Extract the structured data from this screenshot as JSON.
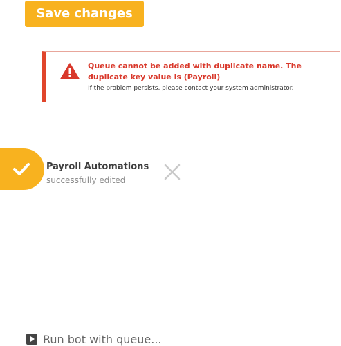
{
  "save_button": {
    "label": "Save changes"
  },
  "error_alert": {
    "icon": "warning-icon",
    "title": "Queue cannot be added with duplicate name. The duplicate key value is (Payroll)",
    "message": "If the problem persists, please contact your system administrator.",
    "accent_color": "#e0452b"
  },
  "toast": {
    "icon": "check-icon",
    "title": "Payroll Automations",
    "message": "successfully edited",
    "accent_color": "#f8b21f"
  },
  "run_bot": {
    "icon": "play-icon",
    "label": "Run bot with queue..."
  }
}
